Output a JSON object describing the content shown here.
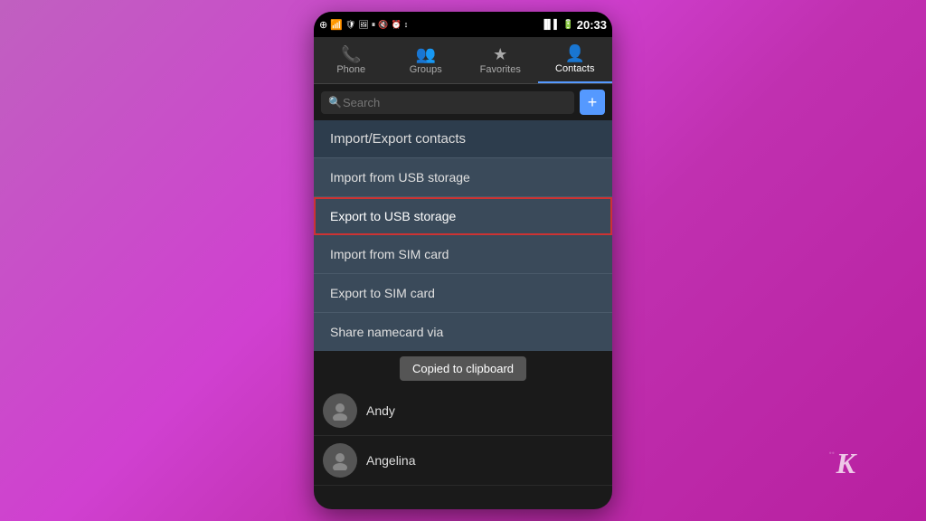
{
  "background": {
    "gradient_start": "#c060c0",
    "gradient_end": "#b820a0"
  },
  "status_bar": {
    "time": "20:33",
    "icons_left": [
      "notification",
      "wifi",
      "shield",
      "image",
      "pause",
      "mute",
      "alarm",
      "sync",
      "signal1"
    ],
    "icons_right": [
      "signal_bars",
      "battery"
    ]
  },
  "nav_tabs": [
    {
      "label": "Phone",
      "icon": "📞",
      "active": false
    },
    {
      "label": "Groups",
      "icon": "👥",
      "active": false
    },
    {
      "label": "Favorites",
      "icon": "★",
      "active": false
    },
    {
      "label": "Contacts",
      "icon": "👤",
      "active": true
    }
  ],
  "search": {
    "placeholder": "Search",
    "add_button_label": "+"
  },
  "dropdown": {
    "header": "Import/Export contacts",
    "items": [
      {
        "label": "Import from USB storage",
        "selected": false
      },
      {
        "label": "Export to USB storage",
        "selected": true
      },
      {
        "label": "Import from SIM card",
        "selected": false
      },
      {
        "label": "Export to SIM card",
        "selected": false
      },
      {
        "label": "Share namecard via",
        "selected": false
      }
    ]
  },
  "contacts": [
    {
      "name": "Andy",
      "has_avatar": true
    },
    {
      "name": "Angelina",
      "has_avatar": true
    }
  ],
  "toast": {
    "message": "Copied to clipboard"
  },
  "branding": {
    "logo": "K"
  }
}
